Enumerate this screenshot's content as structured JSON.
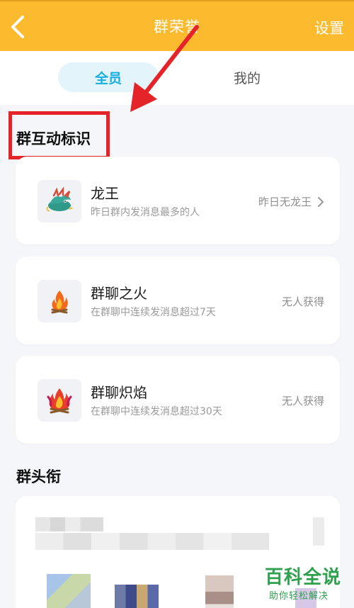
{
  "header": {
    "title": "群荣誉",
    "settings_label": "设置"
  },
  "tabs": {
    "all": "全员",
    "mine": "我的"
  },
  "sections": {
    "interaction_title": "群互动标识",
    "titles_title": "群头衔"
  },
  "badges": [
    {
      "name": "龙王",
      "desc": "昨日群内发消息最多的人",
      "status": "昨日无龙王",
      "icon": "dragon-king-icon"
    },
    {
      "name": "群聊之火",
      "desc": "在群聊中连续发消息超过7天",
      "status": "无人获得",
      "icon": "fire-icon"
    },
    {
      "name": "群聊炽焰",
      "desc": "在群聊中连续发消息超过30天",
      "status": "无人获得",
      "icon": "blazing-fire-icon"
    }
  ],
  "watermark": {
    "main": "百科全说",
    "sub": "助你轻松解决"
  },
  "colors": {
    "header": "#fcba2f",
    "tab_active_bg": "#e3f4fb",
    "tab_active_text": "#17aee0",
    "annotation_red": "#e5242a",
    "watermark_green": "#2ea04e"
  }
}
